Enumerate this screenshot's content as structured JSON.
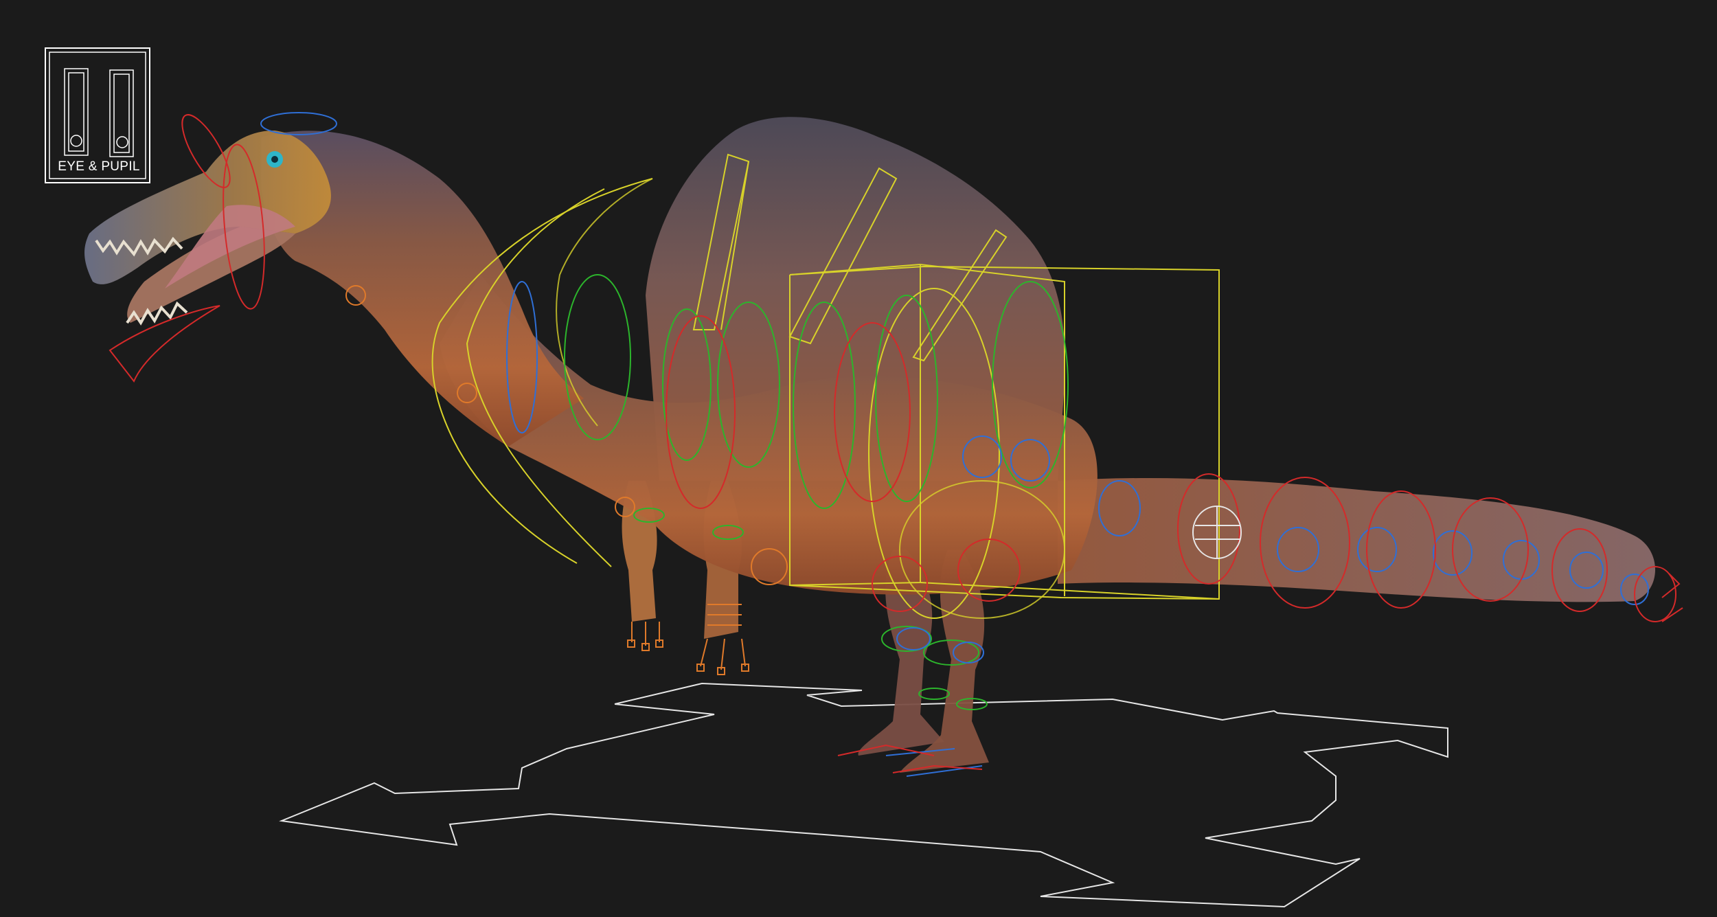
{
  "viewport": {
    "background": "#1b1b1b"
  },
  "eye_panel": {
    "label": "EYE & PUPIL"
  },
  "rig_colors": {
    "fk_right": "#d42a2a",
    "fk_left": "#2f6fd6",
    "ik": "#2cb52c",
    "spine": "#d8d22a",
    "fingers": "#e07a2a",
    "root": "#e6e6e6"
  }
}
